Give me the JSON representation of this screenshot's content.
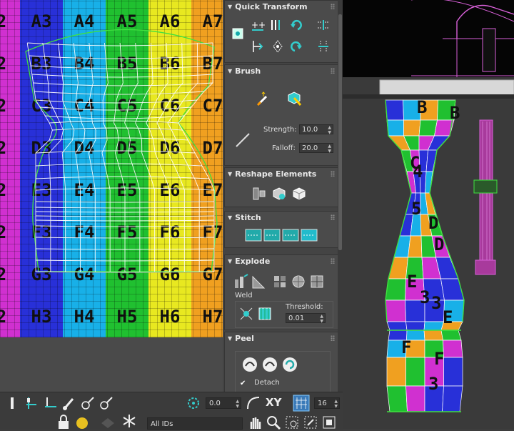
{
  "uv_editor": {
    "grid_rows": [
      {
        "y": 0,
        "cells": [
          "2",
          "A3",
          "A4",
          "A5",
          "A6",
          "A7"
        ]
      },
      {
        "y": 1,
        "cells": [
          "2",
          "B3",
          "B4",
          "B5",
          "B6",
          "B7"
        ]
      },
      {
        "y": 2,
        "cells": [
          "2",
          "C3",
          "C4",
          "C5",
          "C6",
          "C7"
        ]
      },
      {
        "y": 3,
        "cells": [
          "2",
          "D3",
          "D4",
          "D5",
          "D6",
          "D7"
        ]
      },
      {
        "y": 4,
        "cells": [
          "2",
          "E3",
          "E4",
          "E5",
          "E6",
          "E7"
        ]
      },
      {
        "y": 5,
        "cells": [
          "2",
          "F3",
          "F4",
          "F5",
          "F6",
          "F7"
        ]
      },
      {
        "y": 6,
        "cells": [
          "2",
          "G3",
          "G4",
          "G5",
          "G6",
          "G7"
        ]
      },
      {
        "y": 7,
        "cells": [
          "2",
          "H3",
          "H4",
          "H5",
          "H6",
          "H7"
        ]
      }
    ],
    "column_colors": [
      "#d030d0",
      "#2830d8",
      "#18b0e8",
      "#20c030",
      "#e8e820",
      "#f0a020"
    ],
    "mesh_color": "#ffffff",
    "selection_color": "#40e040"
  },
  "panel": {
    "quick_transform": {
      "title": "Quick Transform"
    },
    "brush": {
      "title": "Brush",
      "strength_label": "Strength:",
      "strength_value": "10.0",
      "falloff_label": "Falloff:",
      "falloff_value": "20.0"
    },
    "reshape": {
      "title": "Reshape Elements"
    },
    "stitch": {
      "title": "Stitch"
    },
    "explode": {
      "title": "Explode",
      "weld_label": "Weld",
      "threshold_label": "Threshold:",
      "threshold_value": "0.01"
    },
    "peel": {
      "title": "Peel",
      "detach_label": "Detach",
      "detach_checked": true
    }
  },
  "toolbar": {
    "rotate_value": "0.0",
    "axis_label": "XY",
    "grid_value": "16",
    "element_filter": "All IDs"
  },
  "viewport": {
    "wire_color": "#d860d8",
    "selection_color": "#40e040",
    "letters": [
      "B",
      "C",
      "D",
      "E",
      "F",
      "3",
      "B",
      "D",
      "E",
      "F",
      "3",
      "5",
      "4",
      "3"
    ]
  }
}
